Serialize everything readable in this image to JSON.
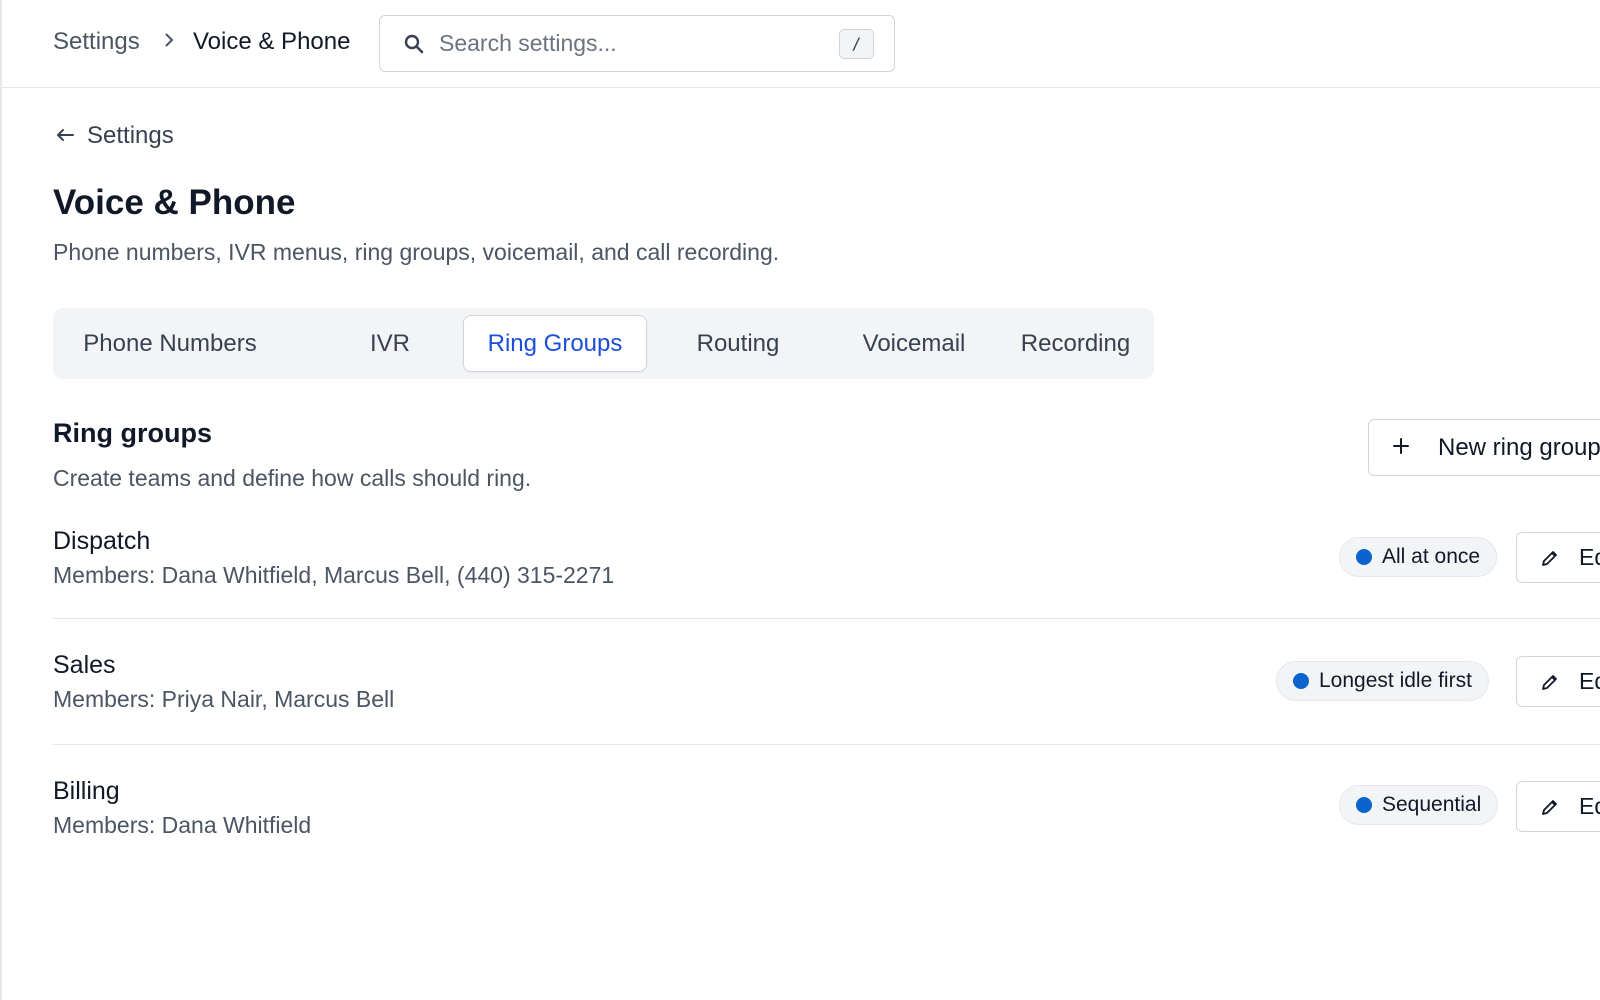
{
  "header": {
    "breadcrumb_root": "Settings",
    "breadcrumb_current": "Voice & Phone",
    "search_placeholder": "Search settings...",
    "search_shortcut": "/"
  },
  "back_link": {
    "icon": "arrow-left-icon",
    "label": "Settings"
  },
  "page": {
    "title": "Voice & Phone",
    "subtitle": "Phone numbers, IVR menus, ring groups, voicemail, and call recording."
  },
  "tabs": [
    {
      "label": "Phone Numbers",
      "active": false
    },
    {
      "label": "IVR",
      "active": false
    },
    {
      "label": "Ring Groups",
      "active": true
    },
    {
      "label": "Routing",
      "active": false
    },
    {
      "label": "Voicemail",
      "active": false
    },
    {
      "label": "Recording",
      "active": false
    }
  ],
  "section": {
    "title": "Ring groups",
    "description": "Create teams and define how calls should ring.",
    "new_button_label": "New ring group",
    "new_button_icon": "plus-icon"
  },
  "groups": [
    {
      "name": "Dispatch",
      "members": "Members: Dana Whitfield, Marcus Bell, (440) 315-2271",
      "strategy": "All at once",
      "edit_label": "Edit"
    },
    {
      "name": "Sales",
      "members": "Members: Priya Nair, Marcus Bell",
      "strategy": "Longest idle first",
      "edit_label": "Edit"
    },
    {
      "name": "Billing",
      "members": "Members: Dana Whitfield",
      "strategy": "Sequential",
      "edit_label": "Edit"
    }
  ],
  "colors": {
    "accent": "#1d4ed8",
    "status_dot": "#0b63ce",
    "border": "#d1d5db",
    "tab_bar_bg": "#f3f4f6"
  }
}
